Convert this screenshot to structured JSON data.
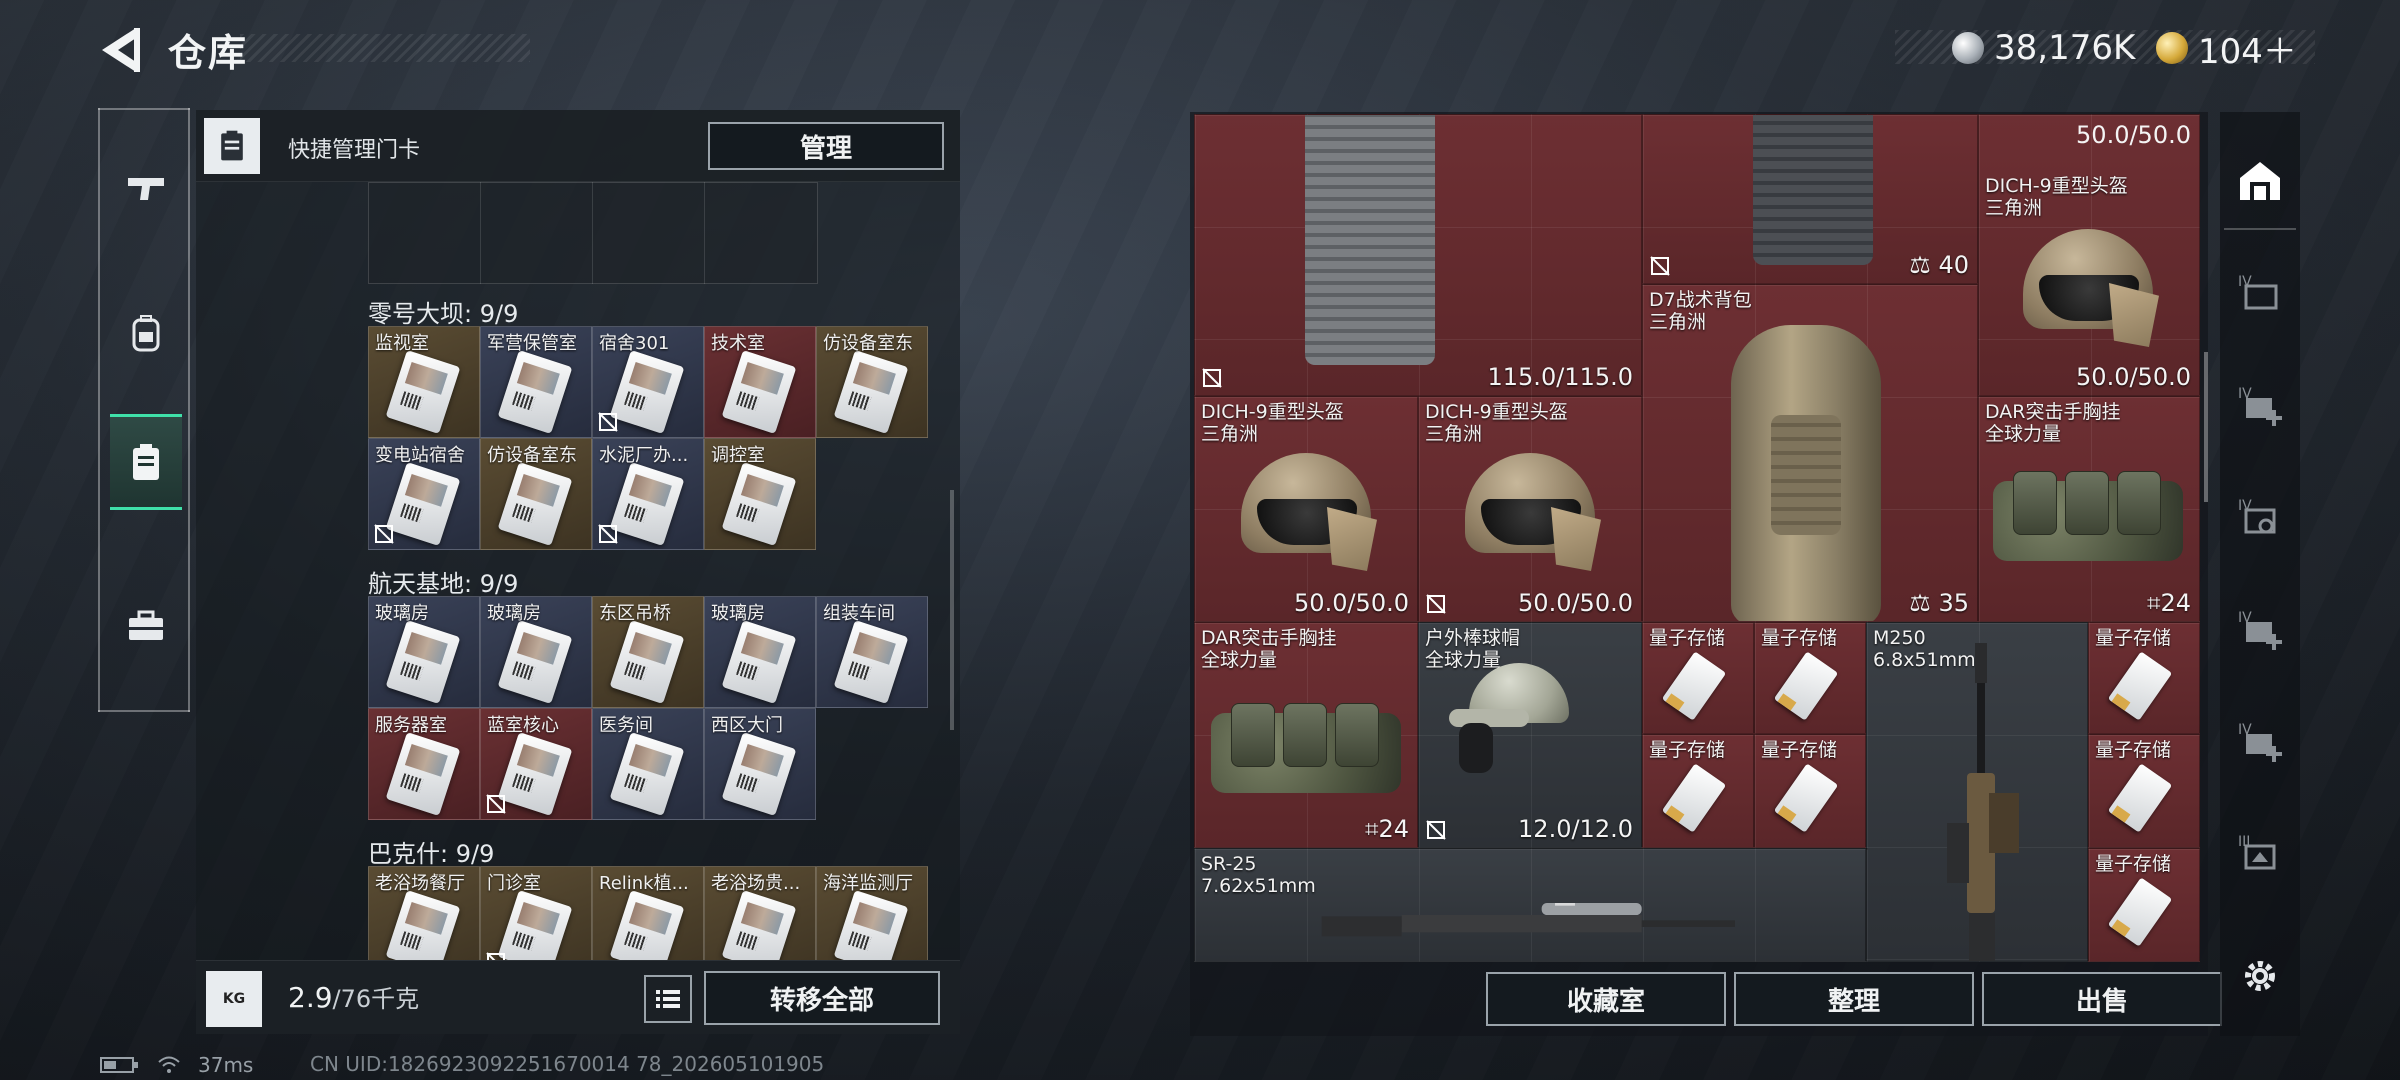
{
  "header": {
    "title": "仓库",
    "currency": [
      {
        "icon": "silver-coin-icon",
        "value": "38,176K"
      },
      {
        "icon": "gold-coin-icon",
        "value": "104＋"
      }
    ]
  },
  "leftnav": {
    "items": [
      {
        "name": "weapons",
        "icon": "pistol-icon",
        "active": false
      },
      {
        "name": "equipment",
        "icon": "backpack-icon",
        "active": false
      },
      {
        "name": "keycards",
        "icon": "keycard-holder-icon",
        "active": true
      },
      {
        "name": "supplies",
        "icon": "toolbox-icon",
        "active": false
      }
    ]
  },
  "keycards": {
    "header_label": "快捷管理门卡",
    "manage_label": "管理",
    "sections": [
      {
        "title": "零号大坝: 9/9",
        "cards": [
          {
            "name": "监视室",
            "color": "gold",
            "unbound": false
          },
          {
            "name": "军营保管室",
            "color": "blue",
            "unbound": false
          },
          {
            "name": "宿舍301",
            "color": "blue",
            "unbound": true
          },
          {
            "name": "技术室",
            "color": "red",
            "unbound": false
          },
          {
            "name": "仿设备室东",
            "color": "gold",
            "unbound": false
          },
          {
            "name": "变电站宿舍",
            "color": "blue",
            "unbound": true
          },
          {
            "name": "仿设备室东",
            "color": "gold",
            "unbound": false
          },
          {
            "name": "水泥厂办...",
            "color": "blue",
            "unbound": true
          },
          {
            "name": "调控室",
            "color": "gold",
            "unbound": false
          }
        ]
      },
      {
        "title": "航天基地: 9/9",
        "cards": [
          {
            "name": "玻璃房",
            "color": "blue",
            "unbound": false
          },
          {
            "name": "玻璃房",
            "color": "blue",
            "unbound": false
          },
          {
            "name": "东区吊桥",
            "color": "gold",
            "unbound": false
          },
          {
            "name": "玻璃房",
            "color": "blue",
            "unbound": false
          },
          {
            "name": "组装车间",
            "color": "blue",
            "unbound": false
          },
          {
            "name": "服务器室",
            "color": "red",
            "unbound": false
          },
          {
            "name": "蓝室核心",
            "color": "red",
            "unbound": true
          },
          {
            "name": "医务间",
            "color": "blue",
            "unbound": false
          },
          {
            "name": "西区大门",
            "color": "blue",
            "unbound": false
          }
        ]
      },
      {
        "title": "巴克什: 9/9",
        "cards": [
          {
            "name": "老浴场餐厅",
            "color": "gold",
            "unbound": false
          },
          {
            "name": "门诊室",
            "color": "gold",
            "unbound": true
          },
          {
            "name": "Relink植...",
            "color": "gold",
            "unbound": false
          },
          {
            "name": "老浴场贵...",
            "color": "gold",
            "unbound": false
          },
          {
            "name": "海洋监测厅",
            "color": "gold",
            "unbound": false
          }
        ]
      }
    ],
    "weight_value": "2.9",
    "weight_max": "/76千克",
    "weight_icon_text": "KG",
    "transfer_all_label": "转移全部"
  },
  "stash": {
    "items": [
      {
        "id": "vest-top",
        "name": "",
        "sub": "",
        "value": "115.0/115.0",
        "unbound": true
      },
      {
        "id": "vest2-top",
        "name": "",
        "sub": "",
        "value": "40",
        "value_icon": "weight-icon",
        "unbound": true
      },
      {
        "id": "helmet-top",
        "name": "DICH-9重型头盔",
        "sub": "三角洲",
        "value": "50.0/50.0",
        "top_value": "50.0/50.0",
        "unbound": false
      },
      {
        "id": "helmet-a",
        "name": "DICH-9重型头盔",
        "sub": "三角洲",
        "value": "50.0/50.0",
        "unbound": false
      },
      {
        "id": "helmet-b",
        "name": "DICH-9重型头盔",
        "sub": "三角洲",
        "value": "50.0/50.0",
        "unbound": true
      },
      {
        "id": "backpack",
        "name": "D7战术背包",
        "sub": "三角洲",
        "value": "35",
        "value_icon": "weight-icon",
        "unbound": false
      },
      {
        "id": "chest-a",
        "name": "DAR突击手胸挂",
        "sub": "全球力量",
        "value": "24",
        "value_icon": "capacity-icon",
        "unbound": false
      },
      {
        "id": "chest-b",
        "name": "DAR突击手胸挂",
        "sub": "全球力量",
        "value": "24",
        "value_icon": "capacity-icon",
        "unbound": false
      },
      {
        "id": "cap",
        "name": "户外棒球帽",
        "sub": "全球力量",
        "value": "12.0/12.0",
        "unbound": true
      },
      {
        "id": "m250",
        "name": "M250",
        "sub": "6.8x51mm",
        "value": "",
        "unbound": false
      },
      {
        "id": "sr25",
        "name": "SR-25",
        "sub": "7.62x51mm",
        "value": "",
        "unbound": false
      }
    ],
    "drives": [
      {
        "name": "量子存储"
      },
      {
        "name": "量子存储"
      },
      {
        "name": "量子存储"
      },
      {
        "name": "量子存储"
      },
      {
        "name": "量子存储"
      },
      {
        "name": "量子存储"
      },
      {
        "name": "量子存储"
      }
    ],
    "buttons": {
      "collection": "收藏室",
      "organize": "整理",
      "sell": "出售"
    }
  },
  "righttabs": [
    {
      "icon": "stash-home-icon"
    },
    {
      "icon": "stash-tab-4-icon"
    },
    {
      "icon": "stash-tab-add-icon"
    },
    {
      "icon": "stash-tab-search-icon"
    },
    {
      "icon": "stash-tab-add-icon"
    },
    {
      "icon": "stash-tab-add-icon"
    },
    {
      "icon": "stash-tab-3-icon"
    },
    {
      "icon": "settings-gear-icon"
    }
  ],
  "status": {
    "ping": "37ms",
    "uid": "CN UID:1826923092251670014 78_202605101905"
  },
  "colors": {
    "accent": "#3fe1a9",
    "stash_red": "#6d2f33",
    "stash_gray": "#3a3f45"
  }
}
